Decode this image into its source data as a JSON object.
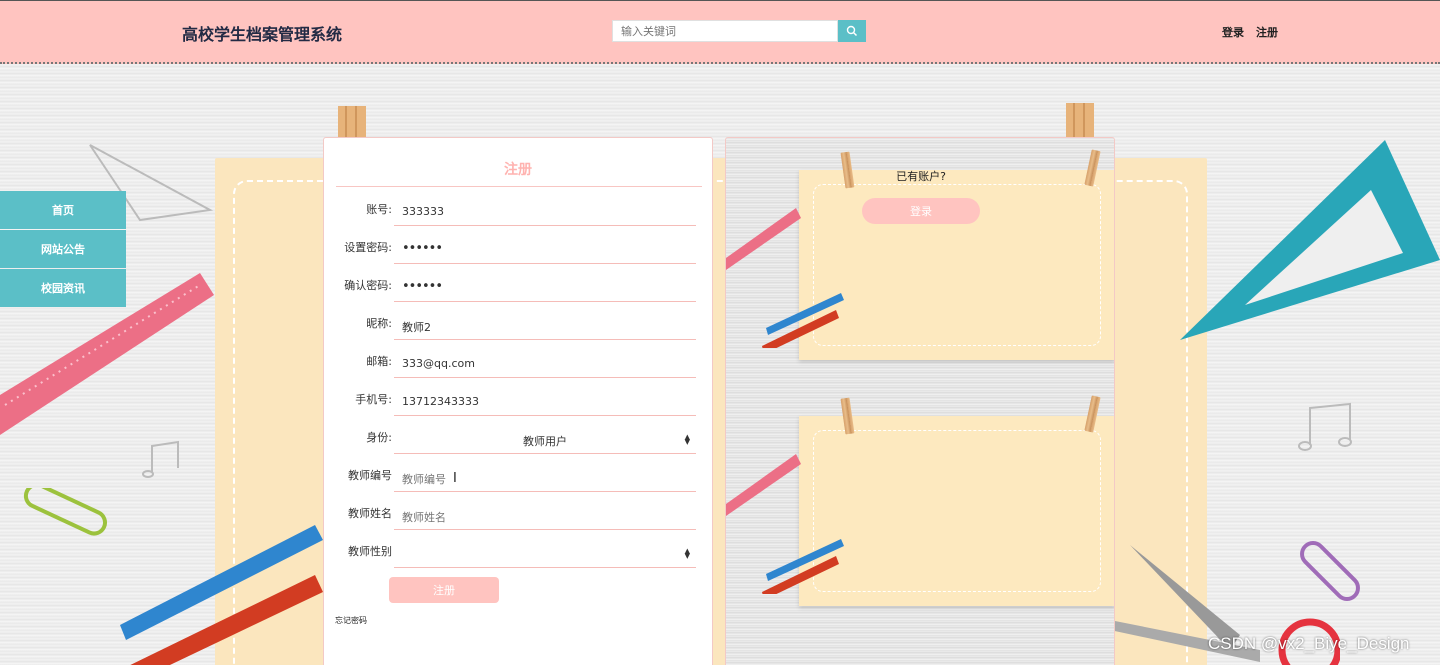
{
  "header": {
    "site_title": "高校学生档案管理系统",
    "search_placeholder": "输入关键词",
    "login_link": "登录",
    "register_link": "注册"
  },
  "sidebar": {
    "items": [
      {
        "label": "首页"
      },
      {
        "label": "网站公告"
      },
      {
        "label": "校园资讯"
      }
    ]
  },
  "register_form": {
    "title": "注册",
    "fields": [
      {
        "label": "账号:",
        "value": "333333",
        "placeholder": ""
      },
      {
        "label": "设置密码:",
        "value": "••••••",
        "placeholder": ""
      },
      {
        "label": "确认密码:",
        "value": "••••••",
        "placeholder": ""
      },
      {
        "label": "昵称:",
        "value": "教师2",
        "placeholder": ""
      },
      {
        "label": "邮箱:",
        "value": "333@qq.com",
        "placeholder": ""
      },
      {
        "label": "手机号:",
        "value": "13712343333",
        "placeholder": ""
      },
      {
        "label": "身份:",
        "value": "教师用户",
        "placeholder": ""
      },
      {
        "label": "教师编号",
        "value": "",
        "placeholder": "教师编号"
      },
      {
        "label": "教师姓名",
        "value": "",
        "placeholder": "教师姓名"
      },
      {
        "label": "教师性别",
        "value": "",
        "placeholder": ""
      }
    ],
    "submit_label": "注册",
    "forgot_password": "忘记密码"
  },
  "login_prompt": {
    "question": "已有账户?",
    "login_button": "登录"
  },
  "watermark": "CSDN @vx2_Biye_Design",
  "colors": {
    "header_bg": "#ffc4c0",
    "accent_teal": "#5bbfc7",
    "accent_pink": "#ffb3b0",
    "paper": "#fbe6be"
  },
  "icons": [
    "search-icon",
    "chevron-updown-icon",
    "text-cursor-icon"
  ]
}
